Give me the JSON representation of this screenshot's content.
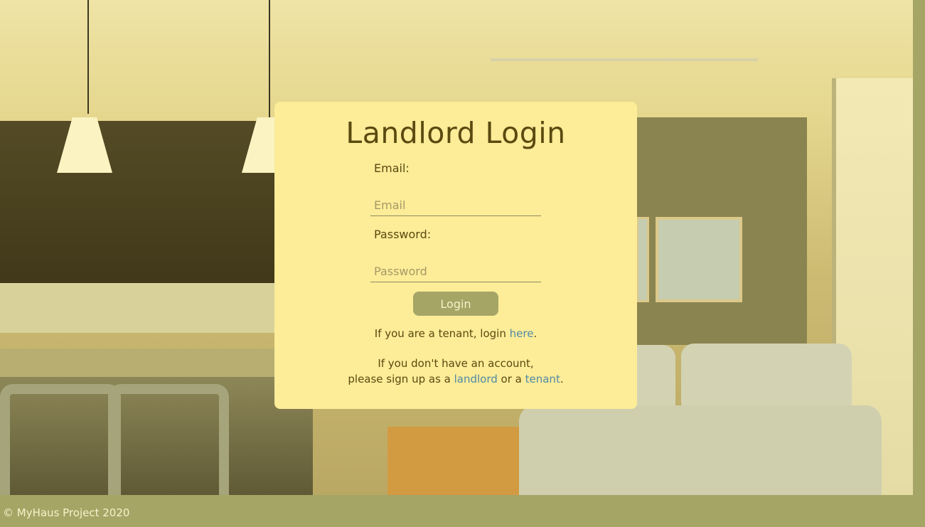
{
  "login": {
    "title": "Landlord Login",
    "email_label": "Email:",
    "email_placeholder": "Email",
    "email_value": "",
    "password_label": "Password:",
    "password_placeholder": "Password",
    "password_value": "",
    "login_button": "Login"
  },
  "tenant_note": {
    "prefix": "If you are a tenant, login ",
    "link": "here",
    "suffix": "."
  },
  "signup_note": {
    "line1": "If you don't have an account,",
    "prefix": "please sign up as a ",
    "landlord_link": "landlord",
    "middle": " or a ",
    "tenant_link": "tenant",
    "suffix": "."
  },
  "footer": {
    "text": "© MyHaus Project 2020"
  },
  "colors": {
    "card_bg": "#fdec98",
    "accent": "#a5a566",
    "link": "#4f8aa6",
    "text": "#5a4a10"
  }
}
